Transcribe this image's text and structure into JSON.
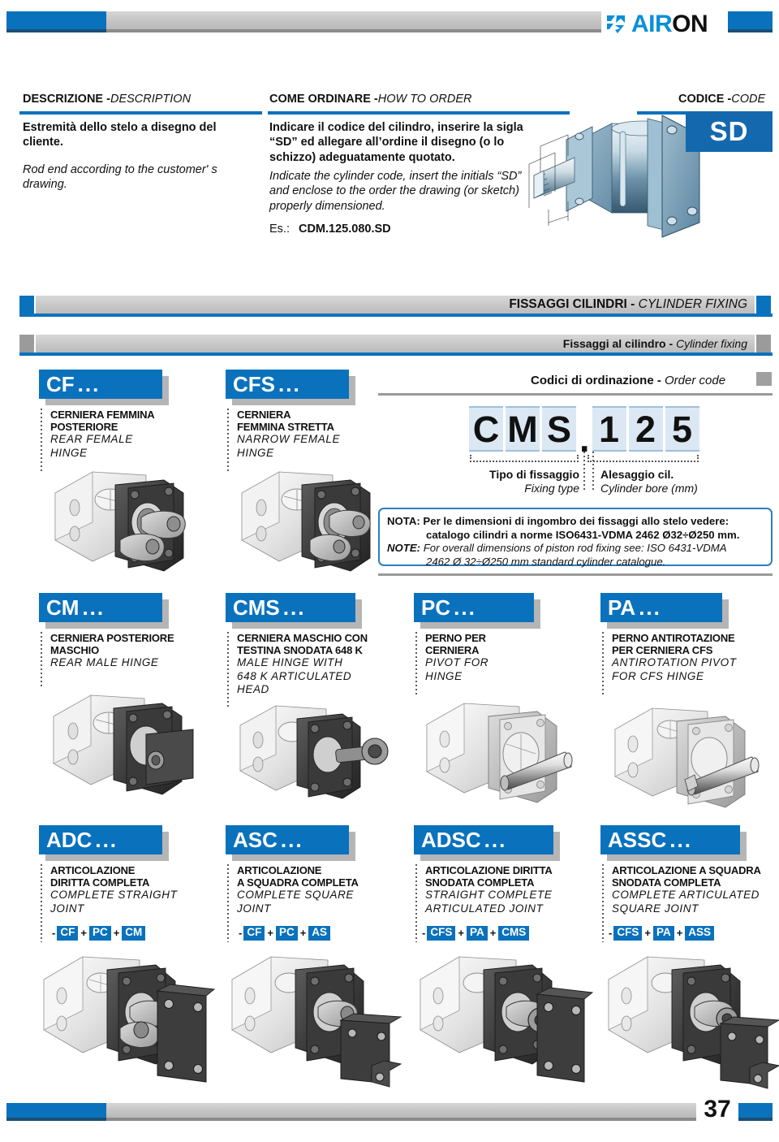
{
  "brand": {
    "name_blue": "AIR",
    "name_black": "ON",
    "logo_icon": "airon-arrows-icon"
  },
  "colors": {
    "accent_blue": "#0a72bd",
    "chip_blue": "#1469ae",
    "bar_gray": "#c6c6c6",
    "code_cell": "#dbe8f3",
    "note_border": "#2a7fc0"
  },
  "headers": {
    "description": {
      "it": "DESCRIZIONE ",
      "sep": "-",
      "en": "DESCRIPTION"
    },
    "how_to_order": {
      "it": "COME ORDINARE ",
      "sep": "-",
      "en": "HOW TO ORDER"
    },
    "code": {
      "it": "CODICE ",
      "sep": "-",
      "en": "CODE"
    }
  },
  "description": {
    "it": "Estremità dello stelo a disegno del cliente.",
    "en": "Rod end according to the customer' s drawing."
  },
  "how_to_order": {
    "it": "Indicare il codice del cilindro, inserire la sigla “SD” ed allegare all’ordine il disegno (o lo schizzo) adeguatamente quotato.",
    "en": "Indicate the cylinder code, insert the initials “SD” and enclose to the order the drawing (or sketch) properly dimensioned.",
    "example_label": "Es.:",
    "example_value": "CDM.125.080.SD"
  },
  "code_chip": "SD",
  "banners": {
    "main": {
      "it": "FISSAGGI CILINDRI",
      "sep": " - ",
      "en": "CYLINDER FIXING"
    },
    "sub": {
      "it": "Fissaggi al cilindro",
      "sep": " -  ",
      "en": "Cylinder fixing"
    }
  },
  "order_code": {
    "title_it": "Codici di ordinazione",
    "title_sep": " -  ",
    "title_en": "Order code",
    "cells": [
      "C",
      "M",
      "S",
      ".",
      "1",
      "2",
      "5"
    ],
    "left_caption": {
      "it": "Tipo di fissaggio",
      "en": "Fixing type"
    },
    "right_caption": {
      "it": "Alesaggio cil.",
      "en": "Cylinder bore (mm)"
    }
  },
  "note": {
    "line1": "NOTA: Per le dimensioni di ingombro dei fissaggi allo stelo vedere:",
    "line2": "catalogo cilindri a norme ISO6431-VDMA 2462 Ø32÷Ø250 mm.",
    "line3_label": "NOTE:",
    "line3": " For overall dimensions of piston rod fixing see: ISO 6431-VDMA",
    "line4": "2462 Ø 32÷Ø250 mm standard cylinder catalogue."
  },
  "products": [
    {
      "code": "CF",
      "dots": "...",
      "it": [
        "CERNIERA FEMMINA",
        "POSTERIORE"
      ],
      "en": [
        "REAR FEMALE",
        "HINGE"
      ],
      "combo": null,
      "figure": "rear-female-hinge-figure"
    },
    {
      "code": "CFS",
      "dots": "...",
      "it": [
        "CERNIERA",
        "FEMMINA STRETTA"
      ],
      "en": [
        "NARROW FEMALE",
        "HINGE"
      ],
      "combo": null,
      "figure": "narrow-female-hinge-figure"
    },
    {
      "code": "CM",
      "dots": "...",
      "it": [
        "CERNIERA POSTERIORE",
        "MASCHIO"
      ],
      "en": [
        "REAR MALE HINGE"
      ],
      "combo": null,
      "figure": "rear-male-hinge-figure"
    },
    {
      "code": "CMS",
      "dots": "...",
      "it": [
        "CERNIERA MASCHIO CON",
        "TESTINA SNODATA 648 K"
      ],
      "en": [
        "MALE HINGE WITH",
        "648 K ARTICULATED",
        "HEAD"
      ],
      "combo": null,
      "figure": "male-hinge-648k-figure"
    },
    {
      "code": "PC",
      "dots": "...",
      "it": [
        "PERNO PER",
        "CERNIERA"
      ],
      "en": [
        "PIVOT FOR",
        "HINGE"
      ],
      "combo": null,
      "figure": "pivot-for-hinge-figure"
    },
    {
      "code": "PA",
      "dots": "...",
      "it": [
        "PERNO ANTIROTAZIONE",
        "PER CERNIERA CFS"
      ],
      "en": [
        "ANTIROTATION PIVOT",
        "FOR CFS HINGE"
      ],
      "combo": null,
      "figure": "antirotation-pivot-figure"
    },
    {
      "code": "ADC",
      "dots": "...",
      "it": [
        "ARTICOLAZIONE",
        "DIRITTA COMPLETA"
      ],
      "en": [
        "COMPLETE STRAIGHT",
        "JOINT"
      ],
      "combo": {
        "dash": "-",
        "tags": [
          "CF",
          "PC",
          "CM"
        ]
      },
      "figure": "complete-straight-joint-figure"
    },
    {
      "code": "ASC",
      "dots": "...",
      "it": [
        "ARTICOLAZIONE",
        "A SQUADRA COMPLETA"
      ],
      "en": [
        "COMPLETE SQUARE",
        "JOINT"
      ],
      "combo": {
        "dash": "-",
        "tags": [
          "CF",
          "PC",
          "AS"
        ]
      },
      "figure": "complete-square-joint-figure"
    },
    {
      "code": "ADSC",
      "dots": "...",
      "it": [
        "ARTICOLAZIONE DIRITTA",
        "SNODATA COMPLETA"
      ],
      "en": [
        "STRAIGHT COMPLETE",
        "ARTICULATED JOINT"
      ],
      "combo": {
        "dash": "-",
        "tags": [
          "CFS",
          "PA",
          "CMS"
        ]
      },
      "figure": "straight-articulated-joint-figure"
    },
    {
      "code": "ASSC",
      "dots": "...",
      "it": [
        "ARTICOLAZIONE A SQUADRA",
        "SNODATA COMPLETA"
      ],
      "en": [
        "COMPLETE ARTICULATED",
        "SQUARE JOINT"
      ],
      "combo": {
        "dash": "-",
        "tags": [
          "CFS",
          "PA",
          "ASS"
        ]
      },
      "figure": "square-articulated-joint-figure"
    }
  ],
  "footer": {
    "page_number": "37"
  }
}
